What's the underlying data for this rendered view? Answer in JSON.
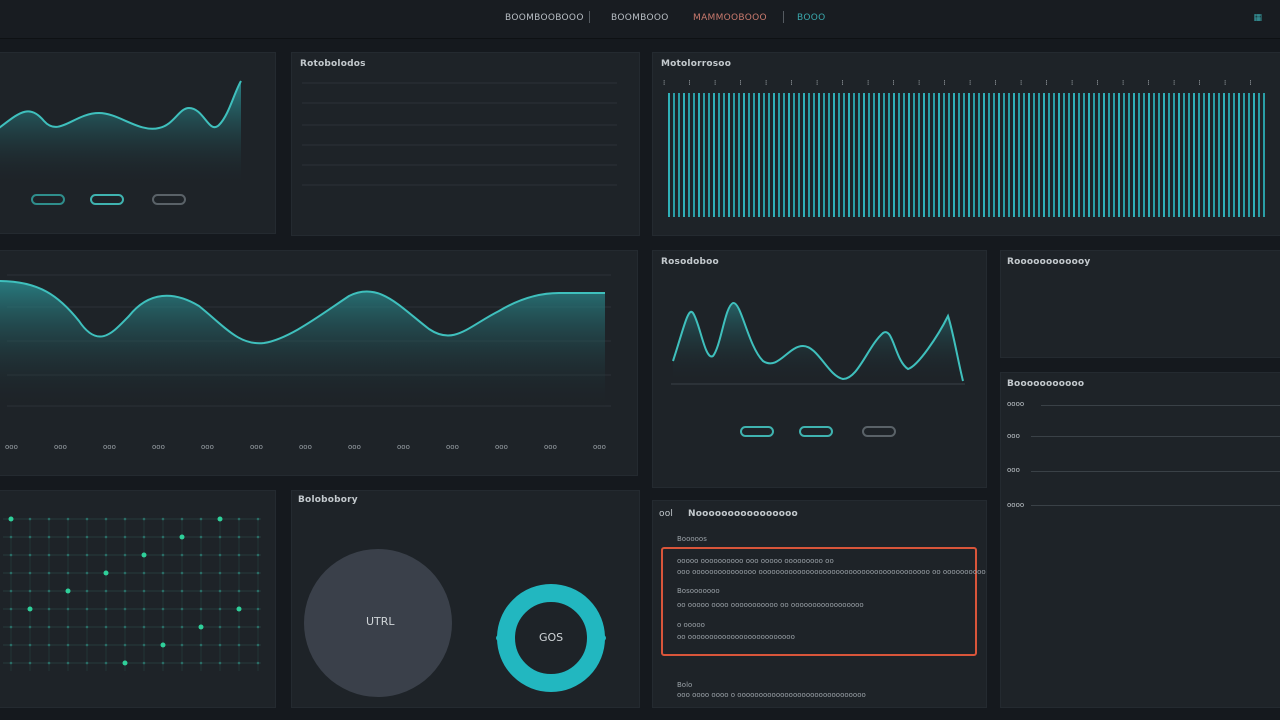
{
  "topbar": {
    "tabs": [
      {
        "label": "BOOMBOOBOOO",
        "state": "normal"
      },
      {
        "label": "BOOMBOOO",
        "state": "normal"
      },
      {
        "label": "MAMMOOBOOO",
        "state": "active"
      },
      {
        "label": "BOOO",
        "state": "teal"
      }
    ],
    "right_icon": "grid-icon"
  },
  "colors": {
    "background": "#15191e",
    "panel": "#1e2328",
    "accent": "#3fb3b0",
    "alert": "#d9553a"
  },
  "panels": {
    "top_left": {
      "title": "",
      "pills": [
        "",
        "",
        ""
      ]
    },
    "top_middle": {
      "title": "Rotobolodos"
    },
    "top_right": {
      "title": "Motolorrosoo"
    },
    "mid_left": {
      "x_ticks": [
        "ooo",
        "ooo",
        "ooo",
        "ooo",
        "ooo",
        "ooo",
        "ooo",
        "ooo",
        "ooo",
        "ooo",
        "ooo",
        "ooo",
        "ooo"
      ]
    },
    "mid_center": {
      "title": "Rosodoboo"
    },
    "mid_right": {
      "title": "Roooooooooooy"
    },
    "lower_right": {
      "title": "Booooooooooo",
      "rows": [
        "oooo",
        "ooo",
        "ooo",
        "oooo"
      ]
    },
    "bottom_left": {},
    "bottom_middle": {
      "title": "Bolobobory",
      "donut_left_label": "UTRL",
      "donut_right_label": "GOS"
    },
    "bottom_right": {
      "header_num": "ool",
      "header_title": "Noooooooooooooooo",
      "sub_label": "Booooos",
      "alert_lines": [
        "ooooo oooooooooo ooo ooooo ooooooooo oo",
        "ooo ooooooooooooooo oooooooooooooooooooooooooooooooooooooooo oo oooooooooo",
        "Bosooooooo",
        "oo   ooooo oooo  ooooooooooo oo  ooooooooooooooooo",
        "o    ooooo",
        "oo  ooooooooooooooooooooooooo"
      ],
      "footer_lines": [
        "Bolo",
        "ooo oooo oooo o oooooooooooooooooooooooooooooo"
      ]
    }
  }
}
